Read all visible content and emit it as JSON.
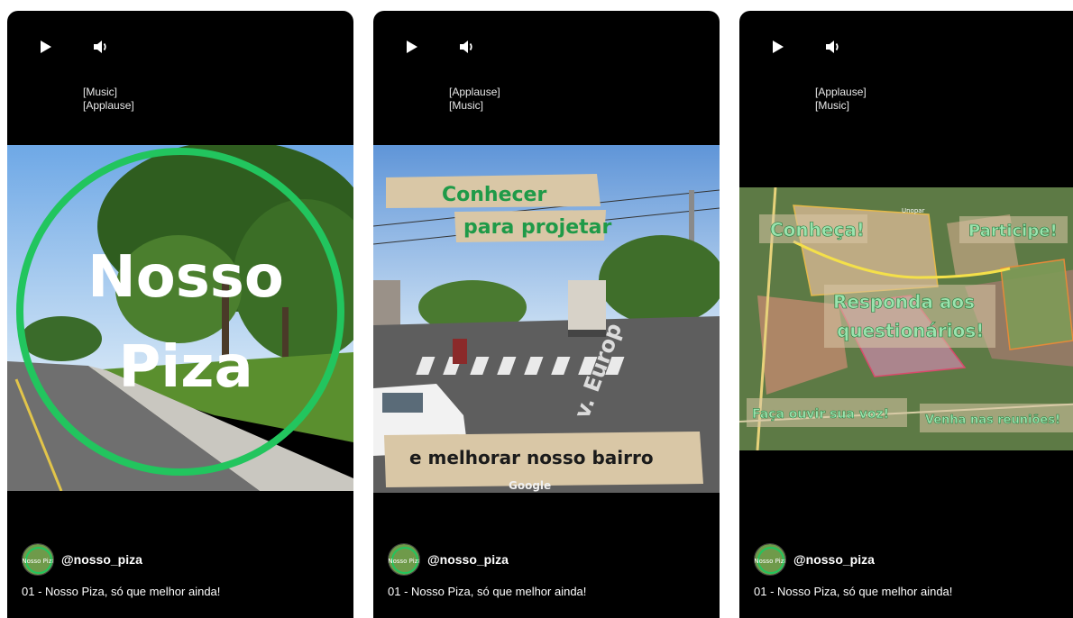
{
  "cards": [
    {
      "captions": [
        "[Music]",
        "[Applause]"
      ],
      "overlay": {
        "line1": "Nosso",
        "line2": "Piza"
      },
      "channel": {
        "handle": "@nosso_piza",
        "avatar_text": "Nosso Piza"
      },
      "video_title": "01 - Nosso Piza, só que melhor ainda!"
    },
    {
      "captions": [
        "[Applause]",
        "[Music]"
      ],
      "overlay": {
        "top_line1": "Conhecer",
        "top_line2": "para projetar",
        "bottom": "e melhorar nosso bairro",
        "street": "v. Europ",
        "watermark": "Google"
      },
      "channel": {
        "handle": "@nosso_piza",
        "avatar_text": "Nosso Piza"
      },
      "video_title": "01 - Nosso Piza, só que melhor ainda!"
    },
    {
      "captions": [
        "[Applause]",
        "[Music]"
      ],
      "overlay": {
        "conheca": "Conheça!",
        "participe": "Participe!",
        "responda1": "Responda aos",
        "responda2": "questionários!",
        "faca": "Faça ouvir sua voz!",
        "venha": "Venha nas reuniões!",
        "map_label": "Unopar"
      },
      "channel": {
        "handle": "@nosso_piza",
        "avatar_text": "Nosso Piza"
      },
      "video_title": "01 - Nosso Piza, só que melhor ainda!"
    }
  ],
  "colors": {
    "overlay_green": "#22c55e",
    "text_green": "#1f9a48",
    "paper": "#d9c7a6",
    "card_bg": "#000000"
  },
  "icons": {
    "play": "play-icon",
    "volume": "volume-icon"
  }
}
